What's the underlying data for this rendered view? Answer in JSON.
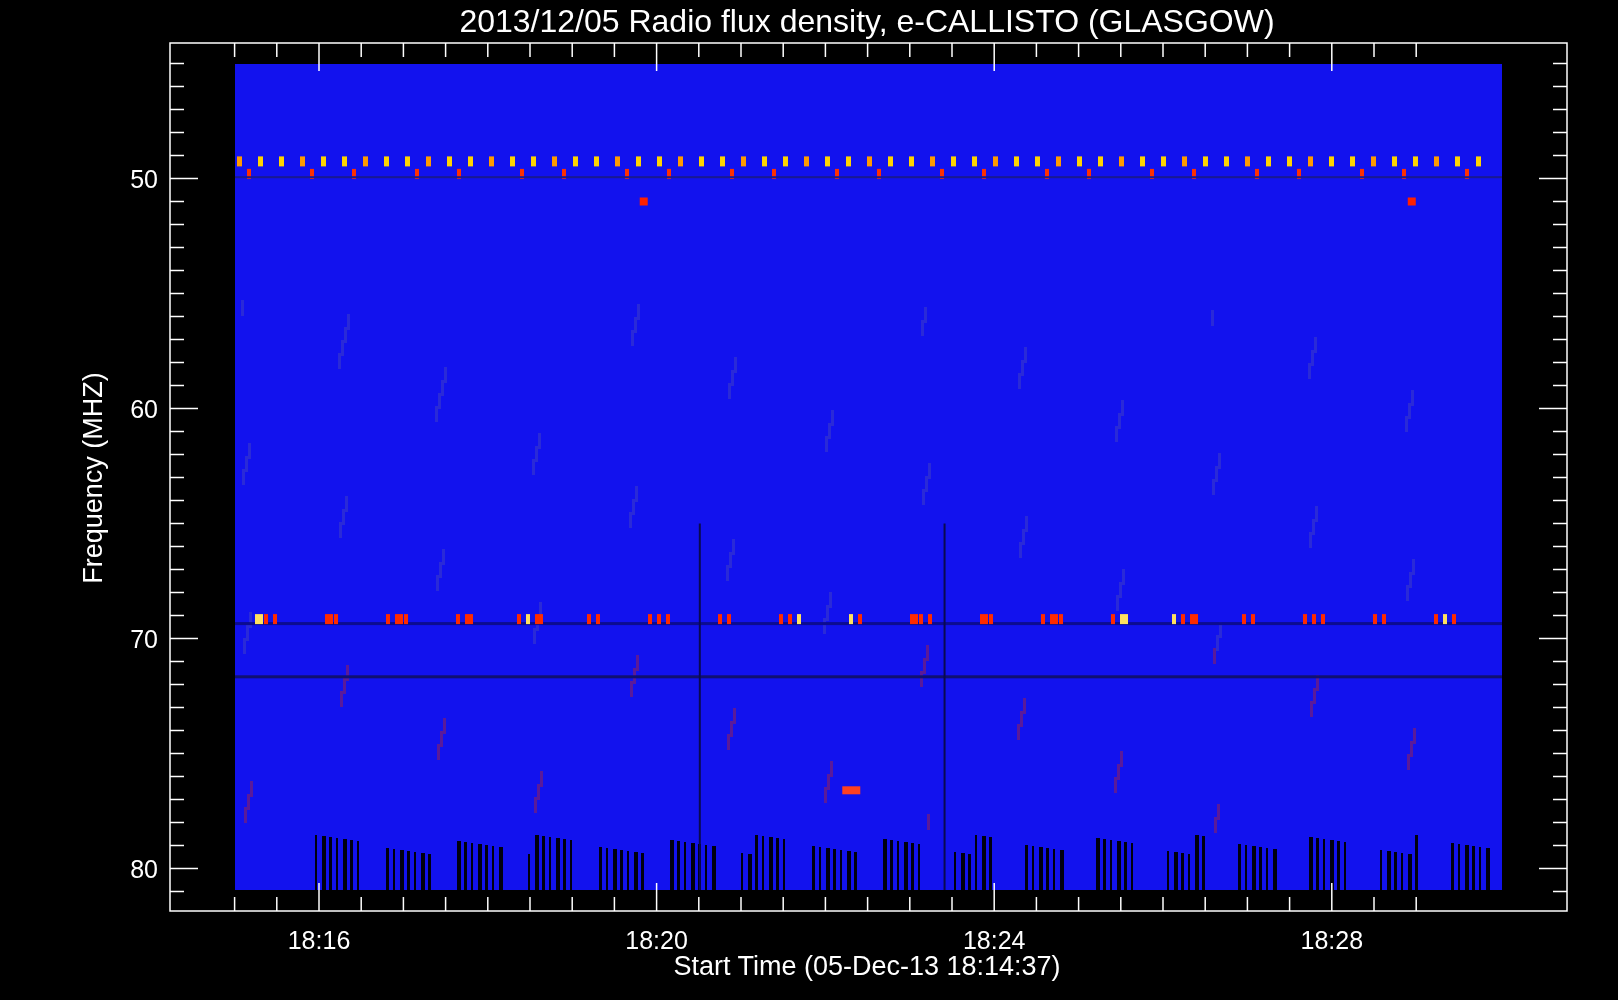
{
  "plot": {
    "title": "2013/12/05  Radio flux density, e-CALLISTO (GLASGOW)",
    "xlabel": "Start Time (05-Dec-13 18:14:37)",
    "ylabel": "Frequency (MHZ)",
    "xticks": [
      "18:16",
      "18:20",
      "18:24",
      "18:28"
    ],
    "yticks": [
      "50",
      "60",
      "70",
      "80"
    ]
  }
}
